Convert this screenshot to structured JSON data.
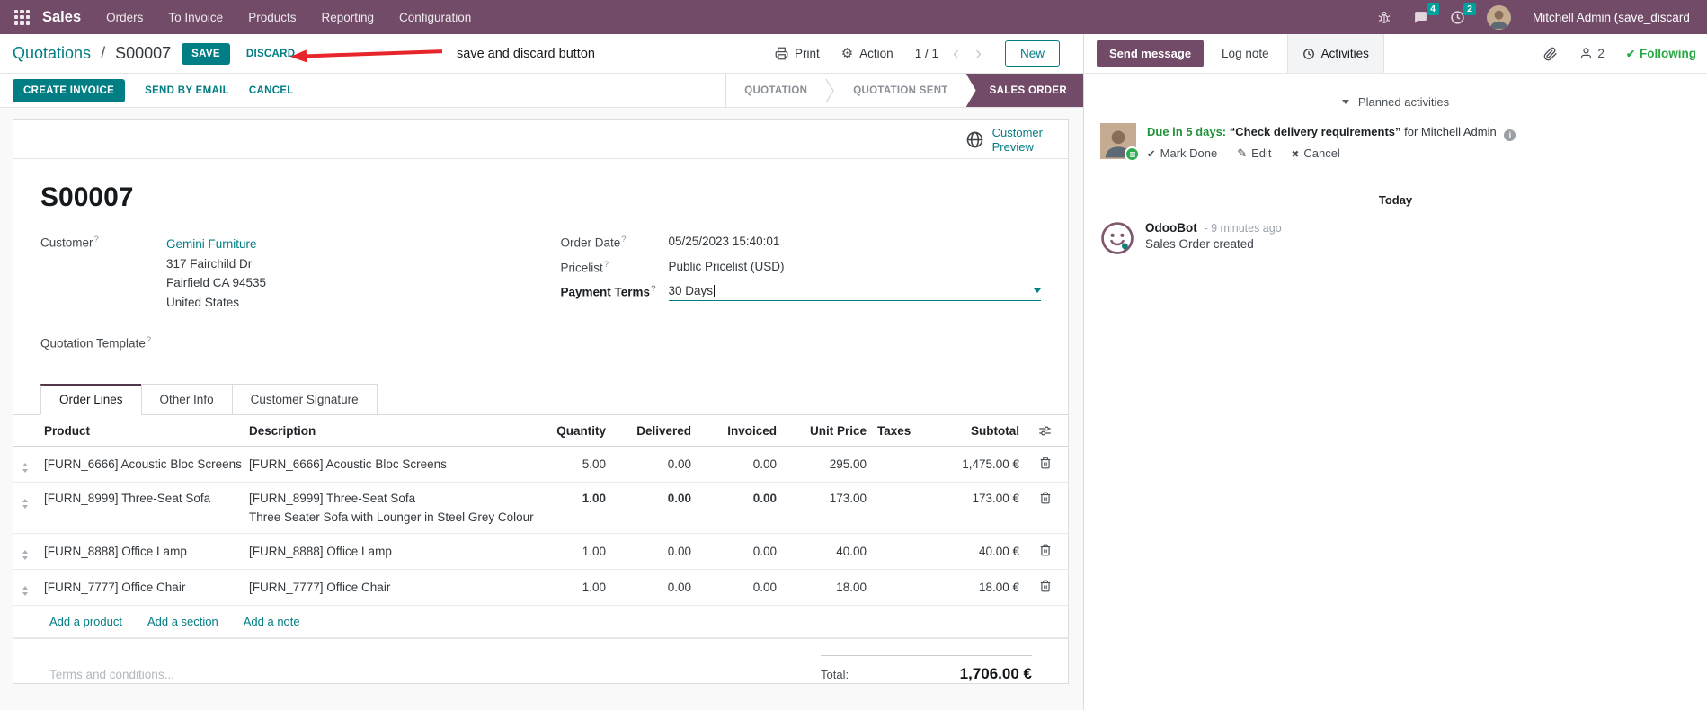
{
  "navbar": {
    "app_label": "Sales",
    "menus": [
      "Orders",
      "To Invoice",
      "Products",
      "Reporting",
      "Configuration"
    ],
    "message_badge": "4",
    "activity_badge": "2",
    "user_name": "Mitchell Admin (save_discard"
  },
  "control": {
    "breadcrumb_parent": "Quotations",
    "breadcrumb_sep": "/",
    "breadcrumb_current": "S00007",
    "save_label": "SAVE",
    "discard_label": "DISCARD",
    "annotation_text": "save and discard button",
    "print_label": "Print",
    "action_label": "Action",
    "pager_value": "1 / 1",
    "new_label": "New"
  },
  "statusbar": {
    "create_invoice_label": "CREATE INVOICE",
    "send_by_email_label": "SEND BY EMAIL",
    "cancel_label": "CANCEL",
    "states": [
      "QUOTATION",
      "QUOTATION SENT",
      "SALES ORDER"
    ],
    "active_state": "SALES ORDER"
  },
  "sheet": {
    "preview_line1": "Customer",
    "preview_line2": "Preview",
    "name": "S00007",
    "help_marker": "?",
    "fields": {
      "customer_label": "Customer",
      "customer_value": "Gemini Furniture",
      "address_line1": "317 Fairchild Dr",
      "address_line2": "Fairfield CA 94535",
      "address_line3": "United States",
      "quotation_template_label": "Quotation Template",
      "order_date_label": "Order Date",
      "order_date_value": "05/25/2023 15:40:01",
      "pricelist_label": "Pricelist",
      "pricelist_value": "Public Pricelist (USD)",
      "payment_terms_label": "Payment Terms",
      "payment_terms_value": "30 Days"
    },
    "tabs": [
      "Order Lines",
      "Other Info",
      "Customer Signature"
    ],
    "table": {
      "headers": {
        "product": "Product",
        "description": "Description",
        "quantity": "Quantity",
        "delivered": "Delivered",
        "invoiced": "Invoiced",
        "unit_price": "Unit Price",
        "taxes": "Taxes",
        "subtotal": "Subtotal"
      },
      "rows": [
        {
          "product": "[FURN_6666] Acoustic Bloc Screens",
          "desc1": "[FURN_6666] Acoustic Bloc Screens",
          "quantity": "5.00",
          "delivered": "0.00",
          "invoiced": "0.00",
          "unit_price": "295.00",
          "subtotal": "1,475.00 €"
        },
        {
          "product": "[FURN_8999] Three-Seat Sofa",
          "desc1": "[FURN_8999] Three-Seat Sofa",
          "desc2": "Three Seater Sofa with Lounger in Steel Grey Colour",
          "quantity": "1.00",
          "delivered": "0.00",
          "invoiced": "0.00",
          "unit_price": "173.00",
          "subtotal": "173.00 €"
        },
        {
          "product": "[FURN_8888] Office Lamp",
          "desc1": "[FURN_8888] Office Lamp",
          "quantity": "1.00",
          "delivered": "0.00",
          "invoiced": "0.00",
          "unit_price": "40.00",
          "subtotal": "40.00 €"
        },
        {
          "product": "[FURN_7777] Office Chair",
          "desc1": "[FURN_7777] Office Chair",
          "quantity": "1.00",
          "delivered": "0.00",
          "invoiced": "0.00",
          "unit_price": "18.00",
          "subtotal": "18.00 €"
        }
      ]
    },
    "links": {
      "add_product": "Add a product",
      "add_section": "Add a section",
      "add_note": "Add a note"
    },
    "terms_placeholder": "Terms and conditions...",
    "total_label": "Total:",
    "total_value": "1,706.00 €"
  },
  "chatter": {
    "send_label": "Send message",
    "log_label": "Log note",
    "activities_label": "Activities",
    "followers_count": "2",
    "following_label": "Following",
    "planned_header": "Planned activities",
    "activity": {
      "due": "Due in 5 days:",
      "summary": "“Check delivery requirements”",
      "for_text": "for Mitchell Admin",
      "mark_done": "Mark Done",
      "edit": "Edit",
      "cancel": "Cancel"
    },
    "today_label": "Today",
    "message": {
      "author": "OdooBot",
      "time": "- 9 minutes ago",
      "body": "Sales Order created"
    }
  },
  "colors": {
    "brand_purple": "#714B67",
    "primary_teal": "#017E84",
    "following_green": "#28a745",
    "modified_blue": "#0d8bd1",
    "annotation_red": "#e8252a",
    "badge_teal": "#00A09D"
  }
}
